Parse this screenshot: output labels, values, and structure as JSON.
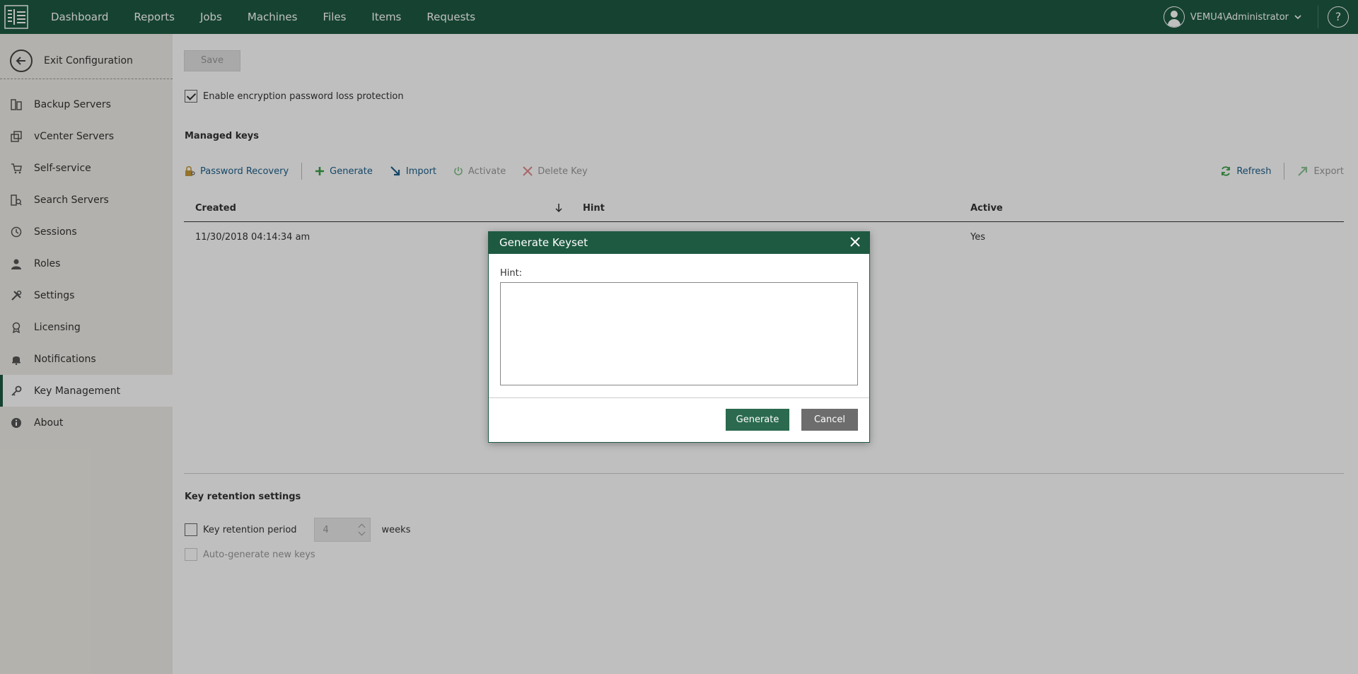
{
  "topbar": {
    "nav": [
      "Dashboard",
      "Reports",
      "Jobs",
      "Machines",
      "Files",
      "Items",
      "Requests"
    ],
    "user": "VEMU4\\Administrator",
    "help": "?"
  },
  "sidebar": {
    "exit_label": "Exit Configuration",
    "items": [
      {
        "label": "Backup Servers",
        "icon": "server-icon"
      },
      {
        "label": "vCenter Servers",
        "icon": "vcenter-icon"
      },
      {
        "label": "Self-service",
        "icon": "cart-icon"
      },
      {
        "label": "Search Servers",
        "icon": "search-server-icon"
      },
      {
        "label": "Sessions",
        "icon": "clock-icon"
      },
      {
        "label": "Roles",
        "icon": "person-icon"
      },
      {
        "label": "Settings",
        "icon": "tools-icon"
      },
      {
        "label": "Licensing",
        "icon": "license-icon"
      },
      {
        "label": "Notifications",
        "icon": "bell-icon"
      },
      {
        "label": "Key Management",
        "icon": "key-icon",
        "active": true
      },
      {
        "label": "About",
        "icon": "info-icon"
      }
    ]
  },
  "main": {
    "save_label": "Save",
    "encryption_label": "Enable encryption password loss protection",
    "encryption_checked": true,
    "managed_keys_title": "Managed keys",
    "toolbar": {
      "password_recovery": "Password Recovery",
      "generate": "Generate",
      "import": "Import",
      "activate": "Activate",
      "delete_key": "Delete Key",
      "refresh": "Refresh",
      "export": "Export"
    },
    "table": {
      "headers": {
        "created": "Created",
        "hint": "Hint",
        "active": "Active"
      },
      "rows": [
        {
          "created": "11/30/2018 04:14:34 am",
          "hint": "",
          "active": "Yes"
        }
      ]
    },
    "retention_title": "Key retention settings",
    "retention_label": "Key retention period",
    "retention_value": "4",
    "retention_unit": "weeks",
    "autogen_label": "Auto-generate new keys"
  },
  "dialog": {
    "title": "Generate Keyset",
    "hint_label": "Hint:",
    "hint_value": "",
    "generate_label": "Generate",
    "cancel_label": "Cancel"
  },
  "colors": {
    "brand": "#1e5a42",
    "link": "#1c5f8a",
    "sidebar_bg": "#efede7"
  }
}
